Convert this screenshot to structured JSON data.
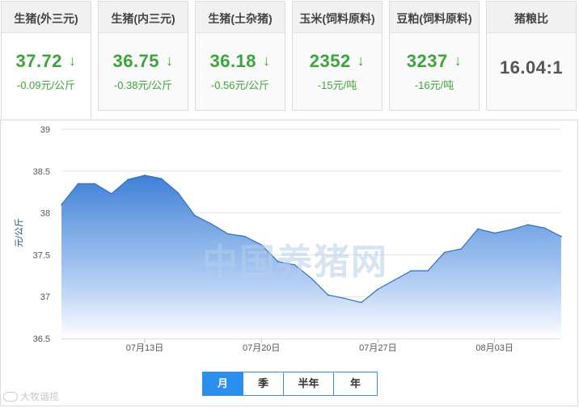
{
  "tabs": [
    {
      "title": "生猪(外三元)",
      "value": "37.72",
      "change": "-0.09元/公斤",
      "trend": "down"
    },
    {
      "title": "生猪(内三元)",
      "value": "36.75",
      "change": "-0.38元/公斤",
      "trend": "down"
    },
    {
      "title": "生猪(土杂猪)",
      "value": "36.18",
      "change": "-0.56元/公斤",
      "trend": "down"
    },
    {
      "title": "玉米(饲料原料)",
      "value": "2352",
      "change": "-15元/吨",
      "trend": "down"
    },
    {
      "title": "豆粕(饲料原料)",
      "value": "3237",
      "change": "-16元/吨",
      "trend": "down"
    },
    {
      "title": "猪粮比",
      "value": "16.04:1",
      "change": "",
      "trend": "none"
    }
  ],
  "down_arrow": "↓",
  "colors": {
    "up_down_green": "#3aa63a",
    "accent_blue": "#2b8ff0",
    "area_top": "#3d7fd6"
  },
  "watermark": "中国养猪网",
  "range_buttons": [
    "月",
    "季",
    "半年",
    "年"
  ],
  "range_active": "月",
  "logo_text": "大牧谐揽",
  "chart_data": {
    "type": "area",
    "title": "",
    "xlabel": "",
    "ylabel": "元/公斤",
    "ylim": [
      36.5,
      39
    ],
    "yticks": [
      "39",
      "38.5",
      "38",
      "37.5",
      "37",
      "36.5"
    ],
    "x": [
      "07月08日",
      "07月09日",
      "07月10日",
      "07月11日",
      "07月12日",
      "07月13日",
      "07月14日",
      "07月15日",
      "07月16日",
      "07月17日",
      "07月18日",
      "07月19日",
      "07月20日",
      "07月21日",
      "07月22日",
      "07月23日",
      "07月24日",
      "07月25日",
      "07月26日",
      "07月27日",
      "07月28日",
      "07月29日",
      "07月30日",
      "07月31日",
      "08月01日",
      "08月02日",
      "08月03日",
      "08月04日",
      "08月05日",
      "08月06日",
      "08月07日"
    ],
    "values": [
      38.1,
      38.35,
      38.35,
      38.23,
      38.4,
      38.45,
      38.41,
      38.24,
      37.97,
      37.87,
      37.75,
      37.72,
      37.62,
      37.42,
      37.38,
      37.22,
      37.02,
      36.98,
      36.93,
      37.09,
      37.2,
      37.31,
      37.31,
      37.53,
      37.57,
      37.81,
      37.76,
      37.8,
      37.86,
      37.82,
      37.72
    ],
    "xticks": [
      "07月13日",
      "07月20日",
      "07月27日",
      "08月03日"
    ],
    "grid": true,
    "legend": "none"
  }
}
